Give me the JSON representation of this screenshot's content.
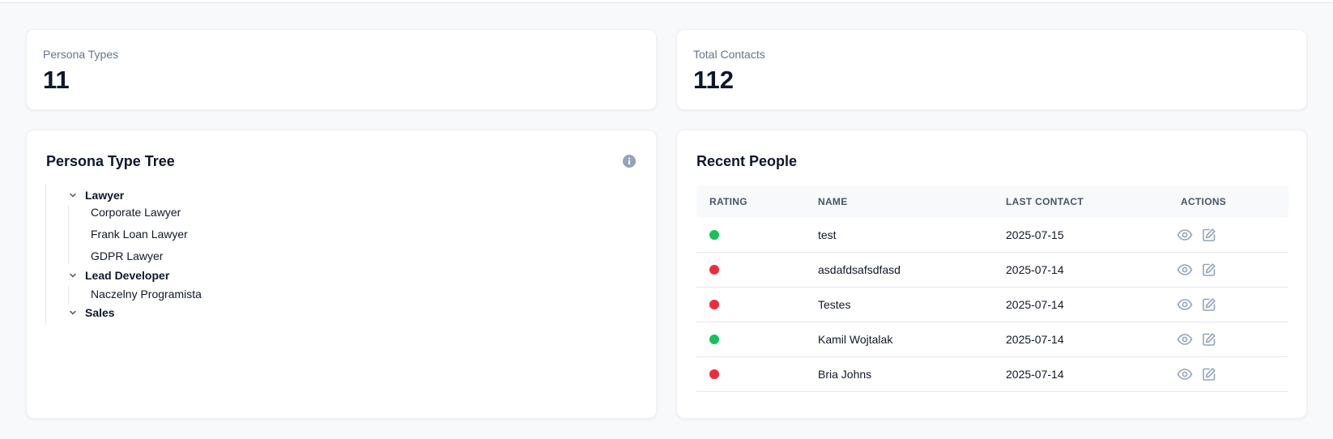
{
  "stats": {
    "persona_types": {
      "label": "Persona Types",
      "value": "11"
    },
    "total_contacts": {
      "label": "Total Contacts",
      "value": "112"
    }
  },
  "tree": {
    "title": "Persona Type Tree",
    "info_icon": "info-icon",
    "nodes": [
      {
        "label": "Lawyer",
        "children": [
          "Corporate Lawyer",
          "Frank Loan Lawyer",
          "GDPR Lawyer"
        ]
      },
      {
        "label": "Lead Developer",
        "children": [
          "Naczelny Programista"
        ]
      },
      {
        "label": "Sales",
        "children": []
      }
    ]
  },
  "people": {
    "title": "Recent People",
    "columns": {
      "rating": "RATING",
      "name": "NAME",
      "last_contact": "LAST CONTACT",
      "actions": "ACTIONS"
    },
    "rows": [
      {
        "rating": "good",
        "name": "test",
        "last_contact": "2025-07-15"
      },
      {
        "rating": "bad",
        "name": "asdafdsafsdfasd",
        "last_contact": "2025-07-14"
      },
      {
        "rating": "bad",
        "name": "Testes",
        "last_contact": "2025-07-14"
      },
      {
        "rating": "good",
        "name": "Kamil Wojtalak",
        "last_contact": "2025-07-14"
      },
      {
        "rating": "bad",
        "name": "Bria Johns",
        "last_contact": "2025-07-14"
      }
    ],
    "rating_colors": {
      "good": "#16c15a",
      "bad": "#ef2b3a"
    },
    "action_icons": [
      "eye-icon",
      "edit-icon"
    ]
  },
  "colors": {
    "muted_icon": "#94a3b8",
    "accent_text": "#0f172a"
  }
}
